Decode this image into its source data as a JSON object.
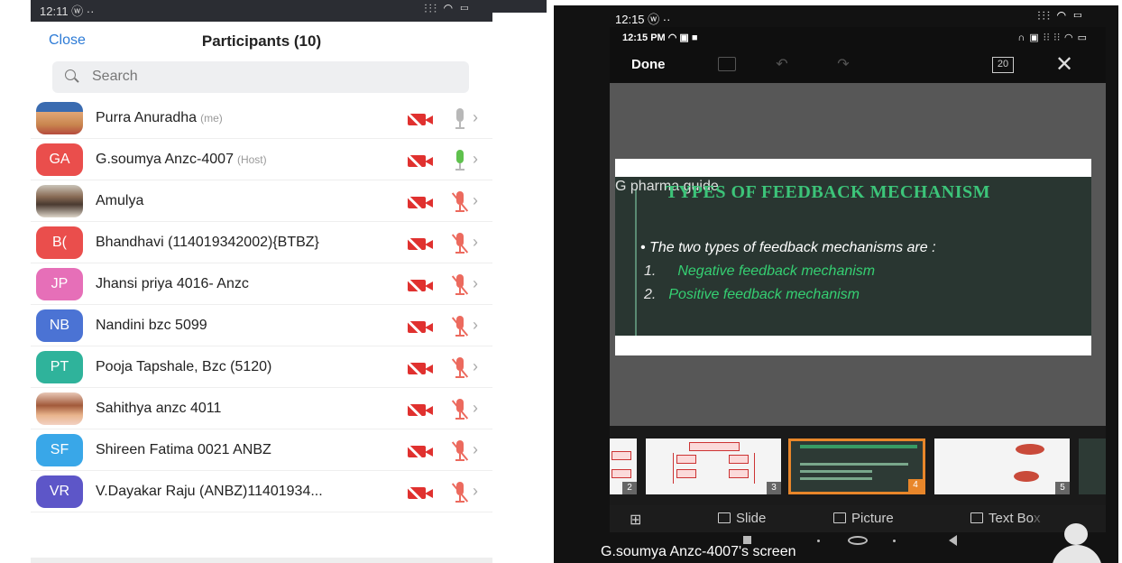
{
  "left": {
    "statusbar": {
      "time": "12:11 ⓦ ··",
      "icons": "⫶⫶⫶ ◠ ▭"
    },
    "header": {
      "close_label": "Close",
      "title": "Participants (10)"
    },
    "search": {
      "placeholder": "Search"
    },
    "participants": [
      {
        "avatar": "",
        "avatar_type": "photo",
        "name": "Purra Anuradha",
        "tag": "(me)",
        "audio": "on"
      },
      {
        "avatar": "GA",
        "avatar_color": "#ea4e4c",
        "name": "G.soumya Anzc-4007",
        "tag": "(Host)",
        "audio": "speaking"
      },
      {
        "avatar": "",
        "avatar_type": "photo",
        "name": "Amulya",
        "tag": "",
        "audio": "muted"
      },
      {
        "avatar": "B(",
        "avatar_color": "#ea4e4c",
        "name": "Bhandhavi (114019342002){BTBZ}",
        "tag": "",
        "audio": "muted"
      },
      {
        "avatar": "JP",
        "avatar_color": "#e66fb8",
        "name": "Jhansi priya 4016- Anzc",
        "tag": "",
        "audio": "muted"
      },
      {
        "avatar": "NB",
        "avatar_color": "#4b73d4",
        "name": "Nandini bzc 5099",
        "tag": "",
        "audio": "muted"
      },
      {
        "avatar": "PT",
        "avatar_color": "#2fb39b",
        "name": "Pooja Tapshale, Bzc (5120)",
        "tag": "",
        "audio": "muted"
      },
      {
        "avatar": "",
        "avatar_type": "photo",
        "name": "Sahithya anzc 4011",
        "tag": "",
        "audio": "muted"
      },
      {
        "avatar": "SF",
        "avatar_color": "#39a7e8",
        "name": "Shireen Fatima 0021 ANBZ",
        "tag": "",
        "audio": "muted"
      },
      {
        "avatar": "VR",
        "avatar_color": "#5d56c8",
        "name": "V.Dayakar Raju (ANBZ)11401934...",
        "tag": "",
        "audio": "muted"
      }
    ]
  },
  "right": {
    "outer_status": {
      "time": "12:15 ⓦ ··",
      "icons": "⫶⫶⫶ ◠ ▭"
    },
    "inner_status": {
      "time": "12:15 PM ◠ ▣ ■",
      "icons": "∩ ▣ ⫶⫶ ⫶⫶ ◠ ▭"
    },
    "toolbar": {
      "done_label": "Done",
      "slide_count_icon": "20"
    },
    "slide": {
      "watermark": "G pharma guide",
      "title": "TYPES OF FEEDBACK MECHANISM",
      "intro": "• The two types of feedback mechanisms are :",
      "items": [
        {
          "num": "1.",
          "text": "Negative feedback mechanism"
        },
        {
          "num": "2.",
          "text": "Positive feedback mechanism"
        }
      ]
    },
    "thumbnails": [
      "2",
      "3",
      "4",
      "5"
    ],
    "bottombar": {
      "slide_label": "Slide",
      "picture_label": "Picture",
      "textbox_label": "Text Bo",
      "textbox_fade": "x"
    },
    "sharer_label": "G.soumya Anzc-4007's screen"
  },
  "colors": {
    "zoom_blue": "#2d7bd6",
    "video_off_red": "#e0312f",
    "mic_muted_red": "#ec6a5e",
    "mic_active_green": "#5fc14d",
    "slide_green": "#3cc479",
    "thumb_selected_orange": "#e8862a"
  }
}
